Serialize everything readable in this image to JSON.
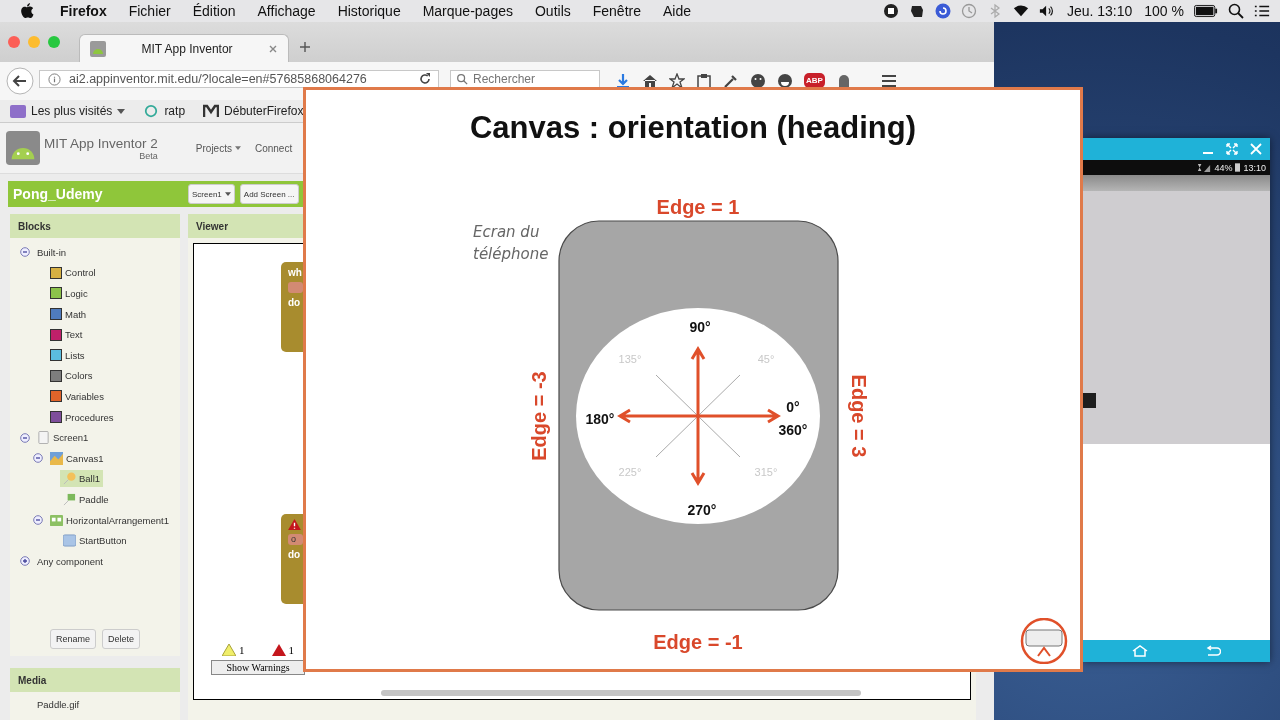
{
  "menubar": {
    "app": "Firefox",
    "menus": [
      "Fichier",
      "Édition",
      "Affichage",
      "Historique",
      "Marque-pages",
      "Outils",
      "Fenêtre",
      "Aide"
    ],
    "clock": "Jeu. 13:10",
    "battery": "100 %"
  },
  "browser": {
    "tab": {
      "title": "MIT App Inventor",
      "selected": true
    },
    "url": "ai2.appinventor.mit.edu/?locale=en#57685868064276",
    "search": {
      "placeholder": "Rechercher"
    },
    "addon_badge": "ABP",
    "bookmarks": [
      "Les plus visités",
      "ratp",
      "DébuterFirefox"
    ]
  },
  "app": {
    "name": "MIT App Inventor 2",
    "badge": "Beta",
    "nav": [
      "Projects",
      "Connect"
    ],
    "project": "Pong_Udemy",
    "screen_button": "Screen1",
    "add_screen": "Add Screen ...",
    "blocks": {
      "title": "Blocks",
      "tree": [
        {
          "label": "Built-in",
          "kind": "group",
          "selected": false,
          "expanded": true,
          "children": [
            {
              "label": "Control",
              "kind": "category",
              "selected": false,
              "color": "#d6b043"
            },
            {
              "label": "Logic",
              "kind": "category",
              "selected": false,
              "color": "#8cc34b"
            },
            {
              "label": "Math",
              "kind": "category",
              "selected": false,
              "color": "#4f7bbd"
            },
            {
              "label": "Text",
              "kind": "category",
              "selected": false,
              "color": "#c0206a"
            },
            {
              "label": "Lists",
              "kind": "category",
              "selected": false,
              "color": "#5bbde0"
            },
            {
              "label": "Colors",
              "kind": "category",
              "selected": false,
              "color": "#7d7d7d"
            },
            {
              "label": "Variables",
              "kind": "category",
              "selected": false,
              "color": "#e0642a"
            },
            {
              "label": "Procedures",
              "kind": "category",
              "selected": false,
              "color": "#7e4e9b"
            }
          ]
        },
        {
          "label": "Screen1",
          "kind": "screen",
          "selected": false,
          "expanded": true,
          "children": [
            {
              "label": "Canvas1",
              "kind": "canvas",
              "selected": false,
              "expanded": true,
              "children": [
                {
                  "label": "Ball1",
                  "kind": "ball",
                  "selected": true
                },
                {
                  "label": "Paddle",
                  "kind": "sprite",
                  "selected": false
                }
              ]
            },
            {
              "label": "HorizontalArrangement1",
              "kind": "arrangement",
              "selected": false,
              "expanded": true,
              "children": [
                {
                  "label": "StartButton",
                  "kind": "button",
                  "selected": false
                }
              ]
            }
          ]
        },
        {
          "label": "Any component",
          "kind": "group",
          "selected": false,
          "expanded": false
        }
      ],
      "buttons": [
        "Rename",
        "Delete"
      ]
    },
    "media": {
      "title": "Media",
      "files": [
        "Paddle.gif"
      ]
    },
    "viewer": {
      "title": "Viewer",
      "code_blocks": [
        {
          "warning": false,
          "head": "wh",
          "body": "do"
        },
        {
          "warning": true,
          "pill": "o",
          "body": "do"
        }
      ],
      "warnings": "1",
      "errors": "1",
      "show_warnings": "Show Warnings"
    }
  },
  "slide": {
    "title": "Canvas : orientation (heading)",
    "note": [
      "Ecran du",
      "téléphone"
    ],
    "edges": [
      "Edge = 1",
      "Edge = -3",
      "Edge = 3",
      "Edge = -1"
    ],
    "angles": [
      {
        "kind": "major",
        "label": "90°"
      },
      {
        "kind": "major",
        "label": "180°"
      },
      {
        "kind": "major",
        "label": "0°"
      },
      {
        "kind": "major",
        "label": "360°"
      },
      {
        "kind": "major",
        "label": "270°"
      },
      {
        "kind": "minor",
        "label": "135°"
      },
      {
        "kind": "minor",
        "label": "45°"
      },
      {
        "kind": "minor",
        "label": "225°"
      },
      {
        "kind": "minor",
        "label": "315°"
      }
    ]
  },
  "emulator": {
    "battery": "44%",
    "time": "13:10"
  }
}
